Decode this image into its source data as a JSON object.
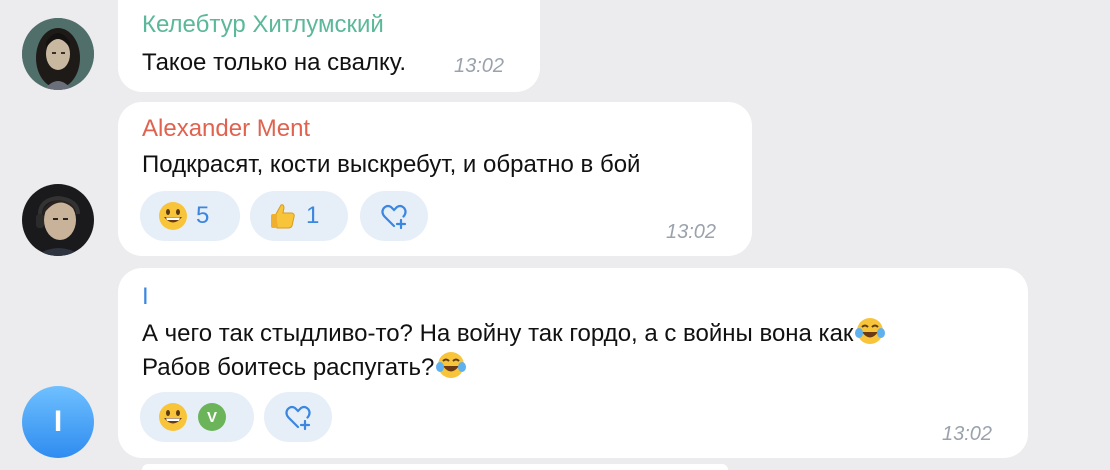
{
  "messages": [
    {
      "sender": "Келебтур Хитлумский",
      "sender_color": "#5bb89a",
      "text": "Такое только на свалку.",
      "time": "13:02"
    },
    {
      "sender": "Alexander Ment",
      "sender_color": "#e0624f",
      "text": "Подкрасят, кости выскребут, и обратно в бой",
      "time": "13:02",
      "reactions": [
        {
          "emoji": "grinning-face",
          "count": "5"
        },
        {
          "emoji": "thumbs-up",
          "count": "1"
        },
        {
          "emoji": "add-reaction"
        }
      ]
    },
    {
      "sender": "I",
      "sender_color": "#3a86e0",
      "avatar_letter": "I",
      "text_line1": "А чего так стыдливо-то? На войну так гордо, а с войны вона как",
      "text_line2": "Рабов боитесь распугать?",
      "time": "13:02",
      "reactions": [
        {
          "emoji": "grinning-face",
          "reactor_badge": "V"
        },
        {
          "emoji": "add-reaction"
        }
      ]
    }
  ],
  "colors": {
    "background": "#ececef",
    "bubble": "#ffffff",
    "reaction_bg": "#e6eef8",
    "accent": "#3a86e0",
    "timestamp": "#9aa3ad"
  }
}
